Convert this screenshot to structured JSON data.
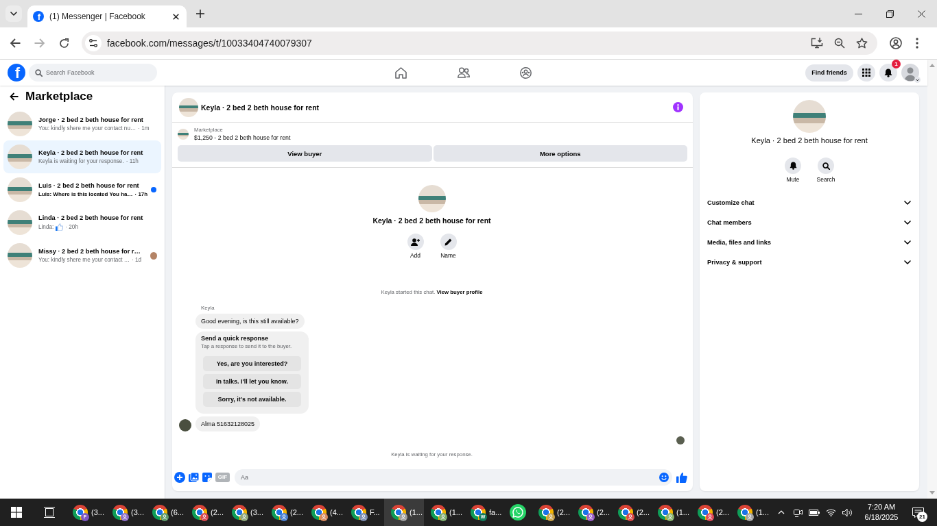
{
  "browser": {
    "tab_logo": "f",
    "tab_title": "(1) Messenger | Facebook",
    "url": "facebook.com/messages/t/10033404740079307"
  },
  "topbar": {
    "logo": "f",
    "search": {
      "placeholder": "Search Facebook"
    },
    "find_friends": "Find friends",
    "notification_count": "1"
  },
  "sidebar": {
    "title": "Marketplace",
    "conversations": [
      {
        "name": "Jorge · 2 bed 2 beth house for rent",
        "kind": "text",
        "preview": "You: kindly shere me your contact nu…",
        "time": "· 1m",
        "selected": false,
        "unread": false,
        "seen": false
      },
      {
        "name": "Keyla · 2 bed 2 beth house for rent",
        "kind": "text",
        "preview": "Keyla is waiting for your response.",
        "time": "· 11h",
        "selected": true,
        "unread": false,
        "seen": false
      },
      {
        "name": "Luis · 2 bed 2 beth house for rent",
        "kind": "text",
        "preview": "Luis: Where is this located You ha…",
        "time": "· 17h",
        "selected": false,
        "unread": true,
        "seen": false
      },
      {
        "name": "Linda · 2 bed 2 beth house for rent",
        "kind": "like",
        "preview": "Linda:",
        "time": "· 20h",
        "selected": false,
        "unread": false,
        "seen": false
      },
      {
        "name": "Missy · 2 bed 2 beth house for r…",
        "kind": "text",
        "preview": "You: kindly shere me your contact …",
        "time": "· 1d",
        "selected": false,
        "unread": false,
        "seen": true
      }
    ]
  },
  "chat": {
    "title": "Keyla · 2 bed 2 beth house for rent",
    "listing": {
      "label": "Marketplace",
      "title": "$1,250 - 2 bed 2 beth house for rent"
    },
    "actions": [
      "View buyer",
      "More options"
    ],
    "intro": {
      "title": "Keyla · 2 bed 2 beth house for rent",
      "actions": [
        {
          "kind": "add",
          "label": "Add"
        },
        {
          "kind": "name",
          "label": "Name"
        }
      ]
    },
    "started_note": {
      "text": "Keyla started this chat.",
      "link": "View buyer profile"
    },
    "sender": "Keyla",
    "messages": [
      {
        "kind": "text",
        "text": "Good evening, is this still available?",
        "avatar": false
      },
      {
        "kind": "quick_response",
        "title": "Send a quick response",
        "subtitle": "Tap a response to send it to the buyer.",
        "options": [
          "Yes, are you interested?",
          "In talks. I'll let you know.",
          "Sorry, it's not available."
        ]
      },
      {
        "kind": "text",
        "text": "Alma 51632128025",
        "avatar": true
      }
    ],
    "read_receipt": true,
    "waiting_note": "Keyla is waiting for your response.",
    "composer": {
      "gif_label": "GIF",
      "placeholder": "Aa"
    }
  },
  "details": {
    "title": "Keyla · 2 bed 2 beth house for rent",
    "actions": [
      {
        "kind": "mute",
        "label": "Mute"
      },
      {
        "kind": "search",
        "label": "Search"
      }
    ],
    "sections": [
      {
        "label": "Customize chat",
        "expanded": false
      },
      {
        "label": "Chat members",
        "expanded": false
      },
      {
        "label": "Media, files and links",
        "expanded": false
      },
      {
        "label": "Privacy & support",
        "expanded": false
      }
    ]
  },
  "taskbar": {
    "apps": [
      {
        "kind": "browser",
        "label": "(3...",
        "color": "#7e57c2",
        "badge": "F",
        "selected": false
      },
      {
        "kind": "browser",
        "label": "(3...",
        "color": "#8e6fc9",
        "selected": false
      },
      {
        "kind": "browser",
        "label": "(6...",
        "color": "#5e9a6a",
        "selected": false
      },
      {
        "kind": "browser",
        "label": "(2...",
        "color": "#d9484f",
        "selected": false
      },
      {
        "kind": "browser",
        "label": "(3...",
        "color": "#8ea67a",
        "selected": false
      },
      {
        "kind": "browser",
        "label": "(2...",
        "color": "#4a7fd0",
        "selected": false
      },
      {
        "kind": "browser",
        "label": "(4...",
        "color": "#d98a5e",
        "selected": false
      },
      {
        "kind": "browser",
        "label": "F...",
        "color": "#7d8db0",
        "selected": false
      },
      {
        "kind": "browser",
        "label": "(1...",
        "color": "#9e9e9e",
        "selected": true
      },
      {
        "kind": "browser",
        "label": "(1...",
        "color": "#7fae6e",
        "selected": false
      },
      {
        "kind": "browser",
        "label": "fa...",
        "color": "#137c5b",
        "badge": "W",
        "selected": false
      },
      {
        "kind": "whatsapp",
        "selected": false
      },
      {
        "kind": "browser",
        "label": "(2...",
        "color": "#c9a34a",
        "selected": false
      },
      {
        "kind": "browser",
        "label": "(2...",
        "color": "#9c5fc7",
        "selected": false
      },
      {
        "kind": "browser",
        "label": "(2...",
        "color": "#d94848",
        "selected": false
      },
      {
        "kind": "browser",
        "label": "(1...",
        "color": "#88b46f",
        "selected": false
      },
      {
        "kind": "browser",
        "label": "(2...",
        "color": "#de4a5a",
        "selected": false
      },
      {
        "kind": "browser",
        "label": "(1...",
        "color": "#a3a3a3",
        "selected": false
      }
    ],
    "clock": {
      "time": "7:20 AM",
      "date": "6/18/2025"
    },
    "notification_count": "21"
  }
}
